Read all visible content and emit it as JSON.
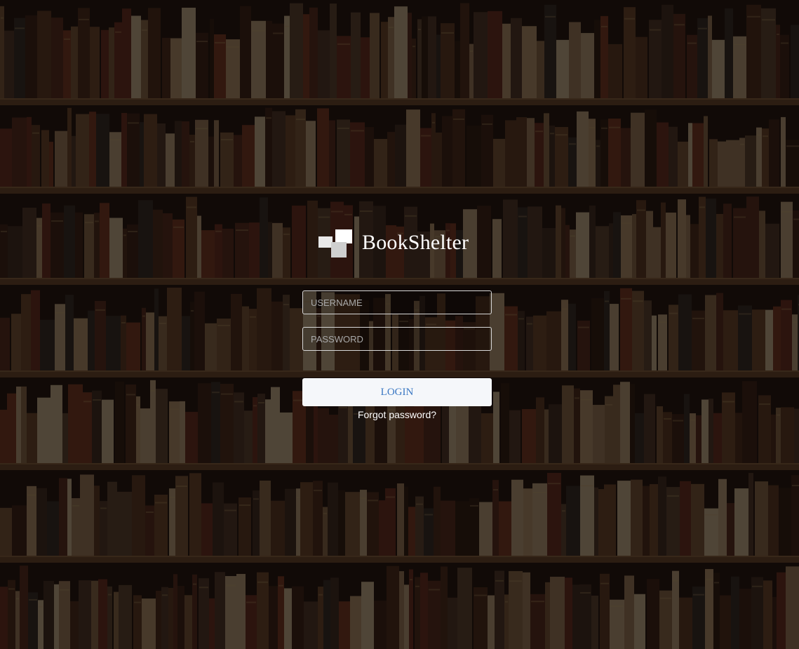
{
  "app": {
    "title": "BookShelter"
  },
  "login_form": {
    "username": {
      "placeholder": "USERNAME",
      "value": ""
    },
    "password": {
      "placeholder": "PASSWORD",
      "value": ""
    },
    "login_label": "LOGIN",
    "forgot_label": "Forgot password?"
  },
  "colors": {
    "login_text": "#3b78c3",
    "login_bg": "#f5f7fa",
    "field_border": "#d8d8d8"
  },
  "icons": {
    "logo": "bookshelter-logo-icon",
    "background": "bookshelf-background-image"
  }
}
